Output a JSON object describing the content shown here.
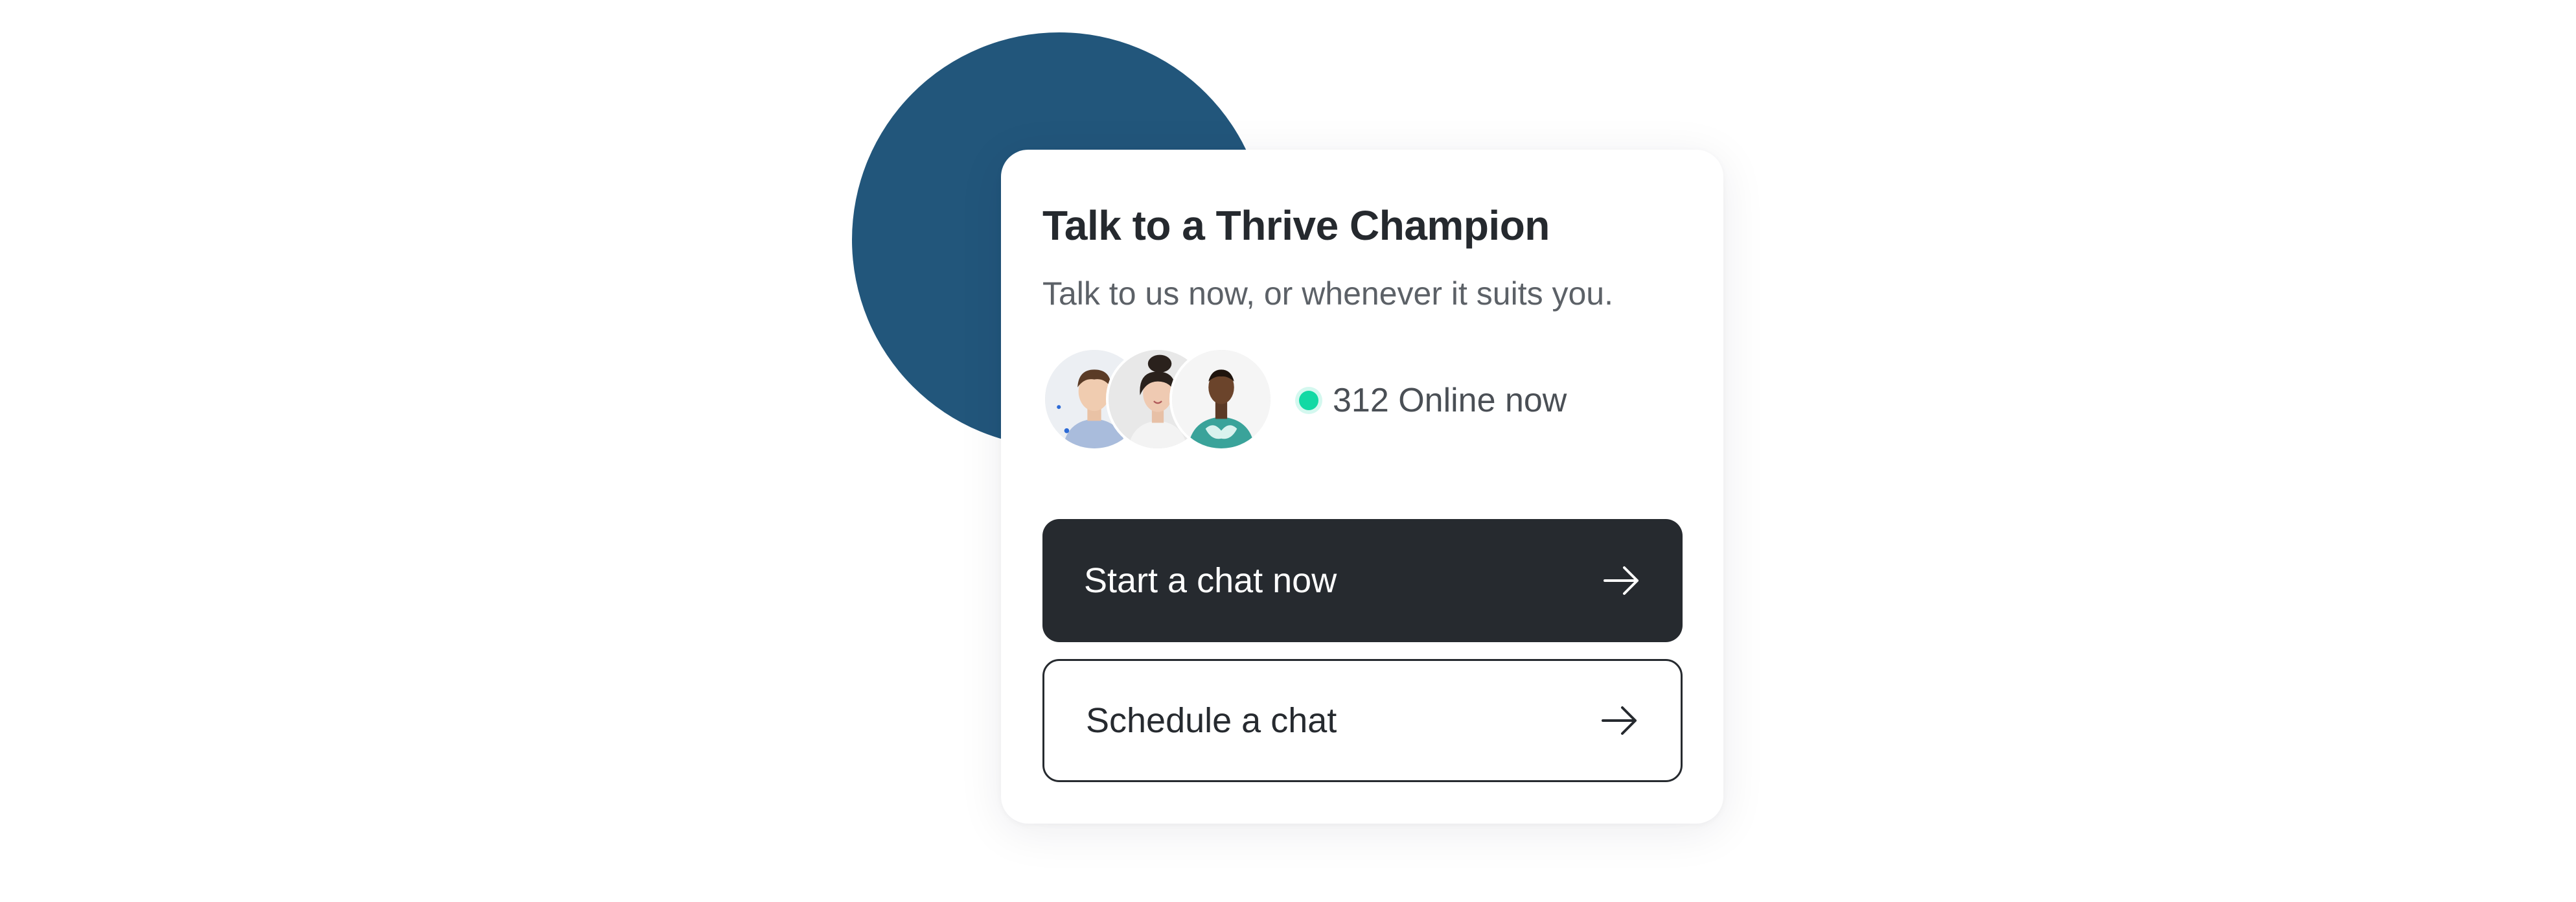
{
  "card": {
    "title": "Talk to a Thrive Champion",
    "subtitle": "Talk to us now, or whenever it suits you."
  },
  "status": {
    "online_text": "312 Online now",
    "dot_color": "#12d9a4"
  },
  "avatars": [
    {
      "icon": "person-avatar-icon"
    },
    {
      "icon": "person-avatar-icon"
    },
    {
      "icon": "person-avatar-icon"
    }
  ],
  "buttons": {
    "start_chat_label": "Start a chat now",
    "schedule_chat_label": "Schedule a chat"
  },
  "colors": {
    "accent_circle": "#22567b",
    "primary_button": "#262a2f",
    "title_text": "#25292e",
    "subtitle_text": "#5c6167"
  }
}
